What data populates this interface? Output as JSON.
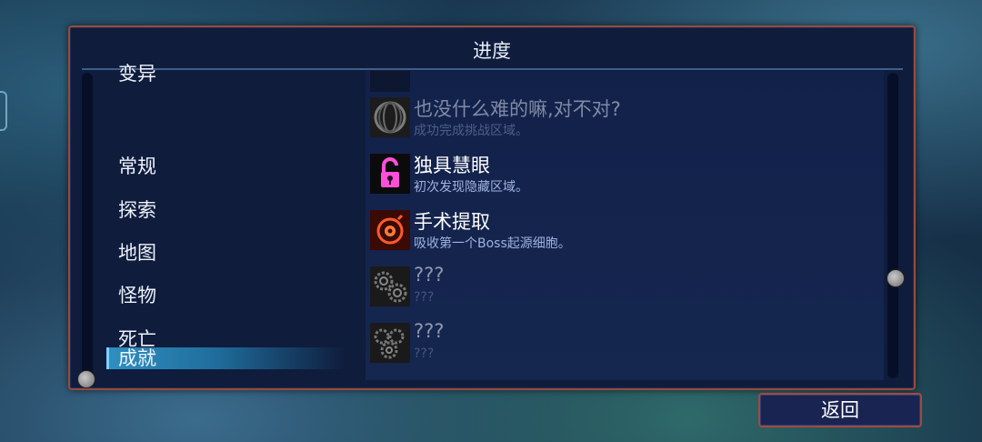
{
  "panel": {
    "title": "进度"
  },
  "categories": [
    {
      "label": "变异",
      "active": false
    },
    {
      "label": "常规",
      "active": false
    },
    {
      "label": "探索",
      "active": false
    },
    {
      "label": "地图",
      "active": false
    },
    {
      "label": "怪物",
      "active": false
    },
    {
      "label": "死亡",
      "active": false
    },
    {
      "label": "成就",
      "active": true
    }
  ],
  "achievements": [
    {
      "name": "也没什么难的嘛,对不对?",
      "desc": "成功完成挑战区域。",
      "icon": "orb-icon",
      "state": "dim"
    },
    {
      "name": "独具慧眼",
      "desc": "初次发现隐藏区域。",
      "icon": "unlocked-padlock-icon",
      "state": "unlocked"
    },
    {
      "name": "手术提取",
      "desc": "吸收第一个Boss起源细胞。",
      "icon": "boss-cell-icon",
      "state": "unlocked"
    },
    {
      "name": "???",
      "desc": "???",
      "icon": "gears-icon",
      "state": "locked"
    },
    {
      "name": "???",
      "desc": "???",
      "icon": "gears-icon",
      "state": "locked"
    }
  ],
  "buttons": {
    "back": "返回"
  },
  "colors": {
    "frame": "#9a4a3a",
    "panel": "#0f1c3c",
    "highlight": "#2f8fc0",
    "pink": "#ff4fd8",
    "orange": "#ff5a2a"
  }
}
